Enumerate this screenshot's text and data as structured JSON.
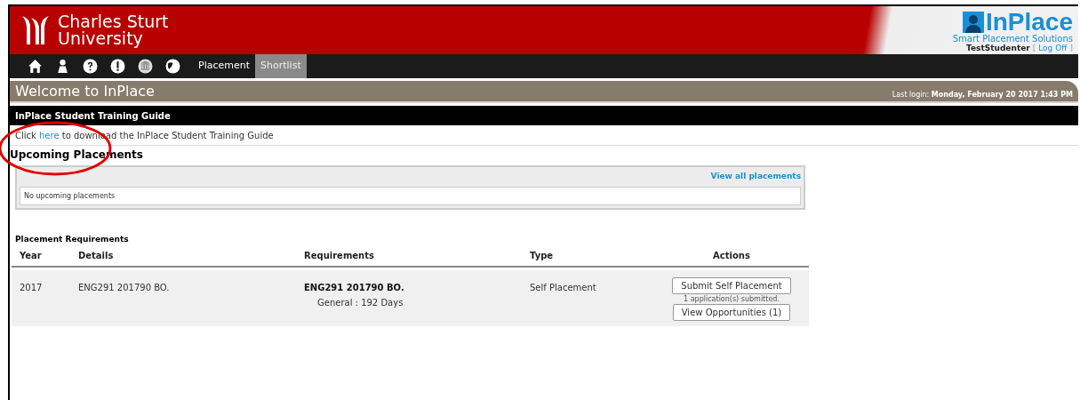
{
  "header": {
    "university": [
      "Charles Sturt",
      "University"
    ],
    "brand": {
      "name": "InPlace",
      "tagline": "Smart Placement Solutions"
    },
    "user": "TestStudenter",
    "logoff_open": "[",
    "logoff": "Log Off",
    "logoff_close": "]"
  },
  "nav": {
    "tabs": [
      {
        "label": "Placement",
        "selected": false
      },
      {
        "label": "Shortlist",
        "selected": true
      }
    ]
  },
  "welcome": {
    "title": "Welcome to InPlace",
    "last_login_label": "Last login:",
    "last_login": "Monday, February 20 2017 1:43 PM"
  },
  "guide": {
    "title": "InPlace Student Training Guide",
    "text_before": "Click",
    "link": "here",
    "text_after": "to download the InPlace Student Training Guide"
  },
  "upcoming": {
    "title": "Upcoming Placements",
    "view_all": "View all placements",
    "empty": "No upcoming placements"
  },
  "requirements": {
    "title": "Placement Requirements",
    "columns": [
      "Year",
      "Details",
      "Requirements",
      "Type",
      "Actions"
    ],
    "rows": [
      {
        "year": "2017",
        "details": "ENG291 201790 BO.",
        "requirement": "ENG291 201790 BO.",
        "requirement_detail": "General : 192 Days",
        "type": "Self Placement",
        "actions": [
          {
            "label": "Submit Self Placement",
            "note": "1 application(s) submitted."
          },
          {
            "label": "View Opportunities (1)"
          }
        ]
      }
    ]
  }
}
